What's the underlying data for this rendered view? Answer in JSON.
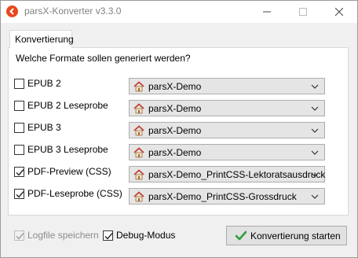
{
  "window": {
    "title": "parsX-Konverter v3.3.0"
  },
  "tabs": [
    {
      "label": "Konvertierung"
    }
  ],
  "question": "Welche Formate sollen generiert werden?",
  "formats": [
    {
      "label": "EPUB 2",
      "checked": false,
      "profile": "parsX-Demo"
    },
    {
      "label": "EPUB 2 Leseprobe",
      "checked": false,
      "profile": "parsX-Demo"
    },
    {
      "label": "EPUB 3",
      "checked": false,
      "profile": "parsX-Demo"
    },
    {
      "label": "EPUB 3 Leseprobe",
      "checked": false,
      "profile": "parsX-Demo"
    },
    {
      "label": "PDF-Preview (CSS)",
      "checked": true,
      "profile": "parsX-Demo_PrintCSS-Lektoratsausdruck"
    },
    {
      "label": "PDF-Leseprobe (CSS)",
      "checked": true,
      "profile": "parsX-Demo_PrintCSS-Grossdruck"
    }
  ],
  "footer": {
    "logfile_label": "Logfile speichern",
    "logfile_checked": true,
    "logfile_enabled": false,
    "debug_label": "Debug-Modus",
    "debug_checked": true,
    "start_label": "Konvertierung starten"
  },
  "colors": {
    "accent": "#e8471e",
    "check_green": "#2e9e3e",
    "house_roof": "#c0392b"
  },
  "icons": {
    "app": "parsx-logo-icon",
    "profile": "house-icon",
    "dropdown": "chevron-down-icon",
    "start": "green-check-icon"
  }
}
